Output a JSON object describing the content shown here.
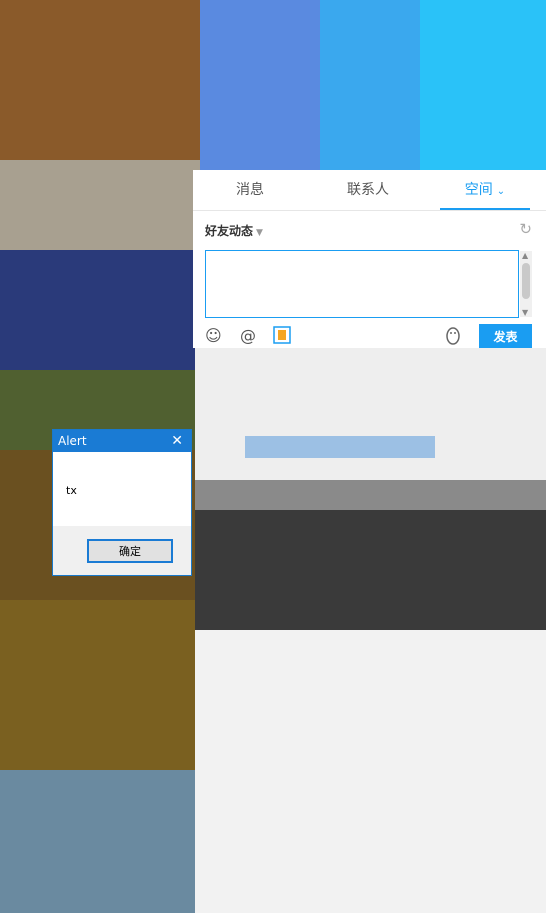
{
  "qq_panel": {
    "tabs": [
      {
        "label": "消息"
      },
      {
        "label": "联系人"
      },
      {
        "label": "空间"
      }
    ],
    "feed_title": "好友动态",
    "send_label": "发表",
    "icons": [
      "smiley-icon",
      "at-icon",
      "photo-icon",
      "qq-penguin-icon",
      "refresh-icon"
    ]
  },
  "alert": {
    "title": "Alert",
    "close": "✕",
    "message": "tx",
    "ok_label": "确定"
  },
  "colors": {
    "accent": "#1a9df2",
    "alert_title": "#1a7bd4"
  }
}
